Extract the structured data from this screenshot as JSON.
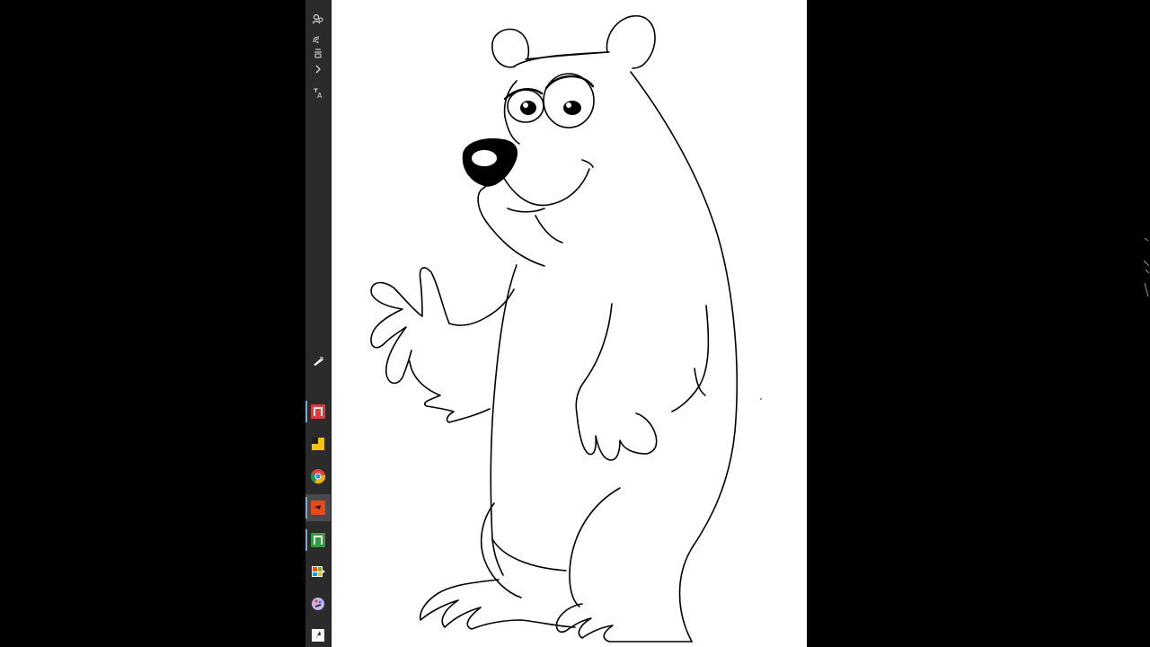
{
  "window": {
    "background": "#000000",
    "canvas_background": "#ffffff"
  },
  "taskbar": {
    "background": "#2b2b2b",
    "tray_icons": [
      {
        "name": "people-icon"
      },
      {
        "name": "wifi-icon"
      },
      {
        "name": "volume-icon"
      },
      {
        "name": "chevron-right-icon"
      },
      {
        "name": "language-icon"
      }
    ],
    "pinned_apps": [
      {
        "name": "app-red-icon",
        "color": "#e53935"
      },
      {
        "name": "sticky-notes-icon",
        "color": "#f4c20d"
      },
      {
        "name": "chrome-icon",
        "color": "#4285f4"
      },
      {
        "name": "video-app-icon",
        "color": "#e64a19",
        "active": true
      },
      {
        "name": "app-green-icon",
        "color": "#2e9e3f"
      },
      {
        "name": "store-icon",
        "color": "#0078d4"
      },
      {
        "name": "paint-icon",
        "color": "#9c7bd6"
      },
      {
        "name": "editor-app-icon",
        "color": "#ffffff"
      }
    ]
  },
  "drawing": {
    "subject": "cartoon-bear-line-drawing",
    "stroke_color": "#000000",
    "nose_color": "#000000"
  }
}
